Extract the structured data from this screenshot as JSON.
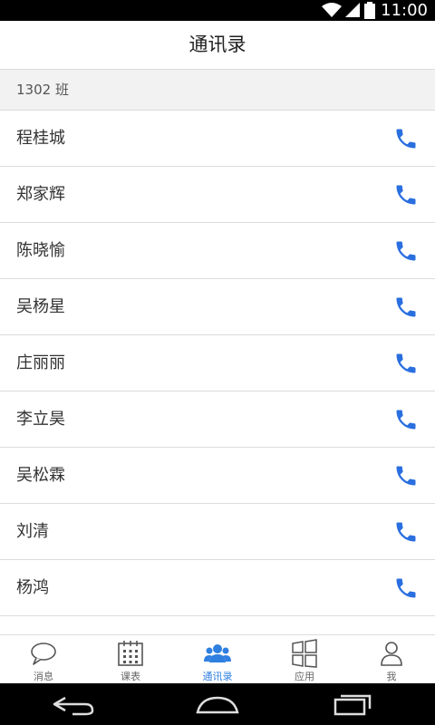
{
  "status_bar": {
    "time": "11:00"
  },
  "header": {
    "title": "通讯录"
  },
  "section": {
    "label": "1302 班"
  },
  "contacts": [
    {
      "name": "程桂城"
    },
    {
      "name": "郑家辉"
    },
    {
      "name": "陈晓愉"
    },
    {
      "name": "吴杨星"
    },
    {
      "name": "庄丽丽"
    },
    {
      "name": "李立昊"
    },
    {
      "name": "吴松霖"
    },
    {
      "name": "刘清"
    },
    {
      "name": "杨鸿"
    },
    {
      "name": ""
    }
  ],
  "tabs": [
    {
      "label": "消息",
      "icon": "message-bubble-icon"
    },
    {
      "label": "课表",
      "icon": "calendar-icon"
    },
    {
      "label": "通讯录",
      "icon": "contacts-group-icon",
      "active": true
    },
    {
      "label": "应用",
      "icon": "apps-grid-icon"
    },
    {
      "label": "我",
      "icon": "person-icon"
    }
  ],
  "colors": {
    "accent": "#2f7fe0",
    "call_icon": "#2a6fe0",
    "divider": "#dcdcdc",
    "section_bg": "#f2f2f2"
  }
}
